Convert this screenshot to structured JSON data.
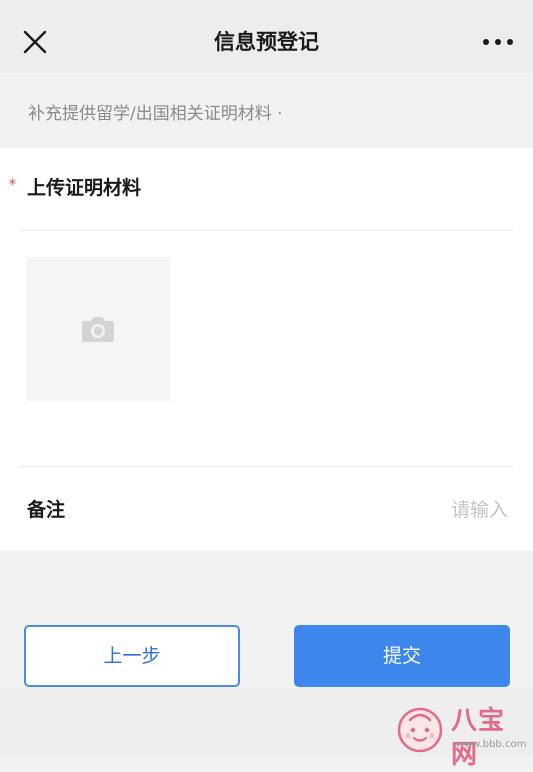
{
  "header": {
    "title": "信息预登记"
  },
  "hint": "补充提供留学/出国相关证明材料 ·",
  "form": {
    "required_mark": "*",
    "upload_label": "上传证明材料",
    "note_label": "备注",
    "note_placeholder": "请输入",
    "note_value": ""
  },
  "buttons": {
    "prev_label": "上一步",
    "submit_label": "提交"
  },
  "watermark": {
    "text": "八宝网",
    "url": "www.bbb.com"
  },
  "colors": {
    "primary": "#3d86ec",
    "required": "#e64340",
    "watermark": "#e56a8a"
  },
  "icons": {
    "close": "close-icon",
    "more": "more-icon",
    "camera": "camera-icon"
  }
}
